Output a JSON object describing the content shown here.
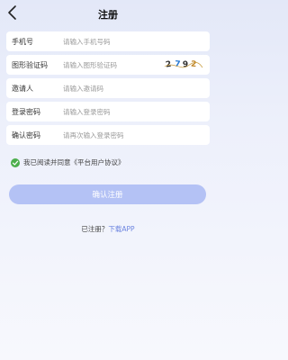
{
  "header": {
    "title": "注册",
    "back_icon": "chevron-left-icon"
  },
  "form": {
    "phone": {
      "label": "手机号",
      "placeholder": "请输入手机号码"
    },
    "captcha": {
      "label": "图形验证码",
      "placeholder": "请输入图形验证码",
      "code": [
        "2",
        "7",
        "9",
        "2"
      ]
    },
    "inviter": {
      "label": "邀请人",
      "placeholder": "请输入邀请码"
    },
    "password": {
      "label": "登录密码",
      "placeholder": "请输入登录密码"
    },
    "confirm_password": {
      "label": "确认密码",
      "placeholder": "请再次输入登录密码"
    }
  },
  "agreement": {
    "checked": true,
    "text": "我已阅读并同意《平台用户协议》",
    "check_color": "#4cae4c"
  },
  "submit": {
    "label": "确认注册",
    "color": "#b4c2f5"
  },
  "footer": {
    "prompt": "已注册？",
    "link": "下载APP",
    "link_color": "#6e86e0"
  }
}
